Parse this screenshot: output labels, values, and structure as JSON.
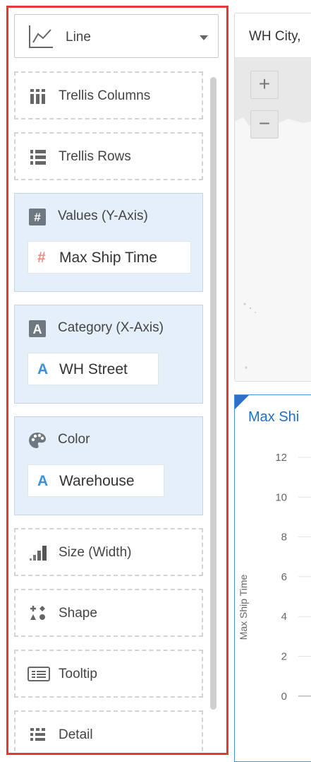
{
  "chart_type_selector": {
    "label": "Line",
    "icon": "line-chart-icon"
  },
  "drop_targets": [
    {
      "id": "trellis-columns",
      "label": "Trellis Columns",
      "icon": "trellis-columns-icon",
      "filled": false
    },
    {
      "id": "trellis-rows",
      "label": "Trellis Rows",
      "icon": "trellis-rows-icon",
      "filled": false
    },
    {
      "id": "values",
      "label": "Values (Y-Axis)",
      "icon": "hash-icon",
      "filled": true,
      "pill": {
        "label": "Max Ship Time",
        "icon": "#",
        "icon_color": "#f08a80"
      }
    },
    {
      "id": "category",
      "label": "Category (X-Axis)",
      "icon": "attribute-a-icon",
      "filled": true,
      "pill": {
        "label": "WH Street",
        "icon": "A",
        "icon_color": "#3d8fd6"
      }
    },
    {
      "id": "color",
      "label": "Color",
      "icon": "palette-icon",
      "filled": true,
      "pill": {
        "label": "Warehouse",
        "icon": "A",
        "icon_color": "#3d8fd6"
      }
    },
    {
      "id": "size",
      "label": "Size (Width)",
      "icon": "size-icon",
      "filled": false
    },
    {
      "id": "shape",
      "label": "Shape",
      "icon": "shape-icon",
      "filled": false
    },
    {
      "id": "tooltip",
      "label": "Tooltip",
      "icon": "tooltip-icon",
      "filled": false
    },
    {
      "id": "detail",
      "label": "Detail",
      "icon": "detail-icon",
      "filled": false
    }
  ],
  "map_view": {
    "title": "WH City,",
    "zoom_in": "+",
    "zoom_out": "−"
  },
  "chart_view": {
    "title": "Max Shi",
    "y_axis_label": "Max Ship Time",
    "y_ticks": [
      "12",
      "10",
      "8",
      "6",
      "4",
      "2",
      "0"
    ]
  },
  "colors": {
    "panel_border": "#e53935",
    "filled_target_bg": "#e4eff9",
    "measure_icon": "#f08a80",
    "attribute_icon": "#3d8fd6",
    "chart_title": "#1f6fc5"
  }
}
